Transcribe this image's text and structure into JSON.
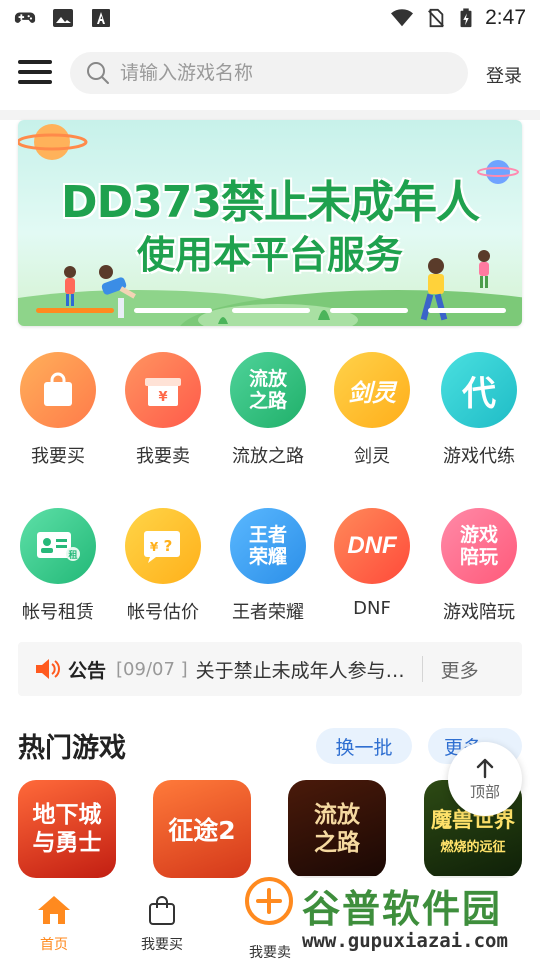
{
  "status_bar": {
    "time": "2:47",
    "left_icons": [
      "gamepad-icon",
      "image-icon",
      "text-a-icon"
    ],
    "right_icons": [
      "wifi-icon",
      "no-sim-icon",
      "battery-charging-icon"
    ]
  },
  "header": {
    "search_placeholder": "请输入游戏名称",
    "login_label": "登录"
  },
  "banner": {
    "line1": "DD373禁止未成年人",
    "line2": "使用本平台服务",
    "slide_count": 5,
    "active_slide": 1
  },
  "categories": [
    {
      "label": "我要买",
      "icon": "shopping-bag-icon"
    },
    {
      "label": "我要卖",
      "icon": "gift-yen-icon"
    },
    {
      "label": "流放之路",
      "icon_text": "流放\n之路"
    },
    {
      "label": "剑灵",
      "icon_text": "剑灵"
    },
    {
      "label": "游戏代练",
      "icon_text": "代"
    },
    {
      "label": "帐号租赁",
      "icon": "id-card-icon"
    },
    {
      "label": "帐号估价",
      "icon": "price-tag-icon"
    },
    {
      "label": "王者荣耀",
      "icon_text": "王者\n荣耀"
    },
    {
      "label": "DNF",
      "icon_text": "DNF"
    },
    {
      "label": "游戏陪玩",
      "icon_text": "游戏\n陪玩"
    }
  ],
  "notice": {
    "title": "公告",
    "date": "[09/07 ]",
    "text": "关于禁止未成年人参与游戏交易的公告",
    "more_label": "更多"
  },
  "hot_games": {
    "title": "热门游戏",
    "refresh_label": "换一批",
    "more_label": "更多 ›",
    "games": [
      {
        "name": "地下城\n与勇士"
      },
      {
        "name": "征途2"
      },
      {
        "name": "流放\n之路"
      },
      {
        "name": "魔兽世界",
        "subtitle": "燃烧的远征"
      }
    ]
  },
  "back_to_top_label": "顶部",
  "bottom_nav": [
    {
      "label": "首页",
      "icon": "home-icon",
      "active": true
    },
    {
      "label": "我要买",
      "icon": "shopping-bag-icon",
      "active": false
    },
    {
      "label": "我要卖",
      "icon": "plus-circle-icon",
      "active": false
    }
  ],
  "watermark": {
    "text": "谷普软件园",
    "url": "www.gupuxiazai.com"
  },
  "colors": {
    "accent": "#ff8a1f",
    "banner_text": "#1fa14e",
    "pill_bg": "#e8f2fd",
    "pill_text": "#2f6fd1"
  }
}
